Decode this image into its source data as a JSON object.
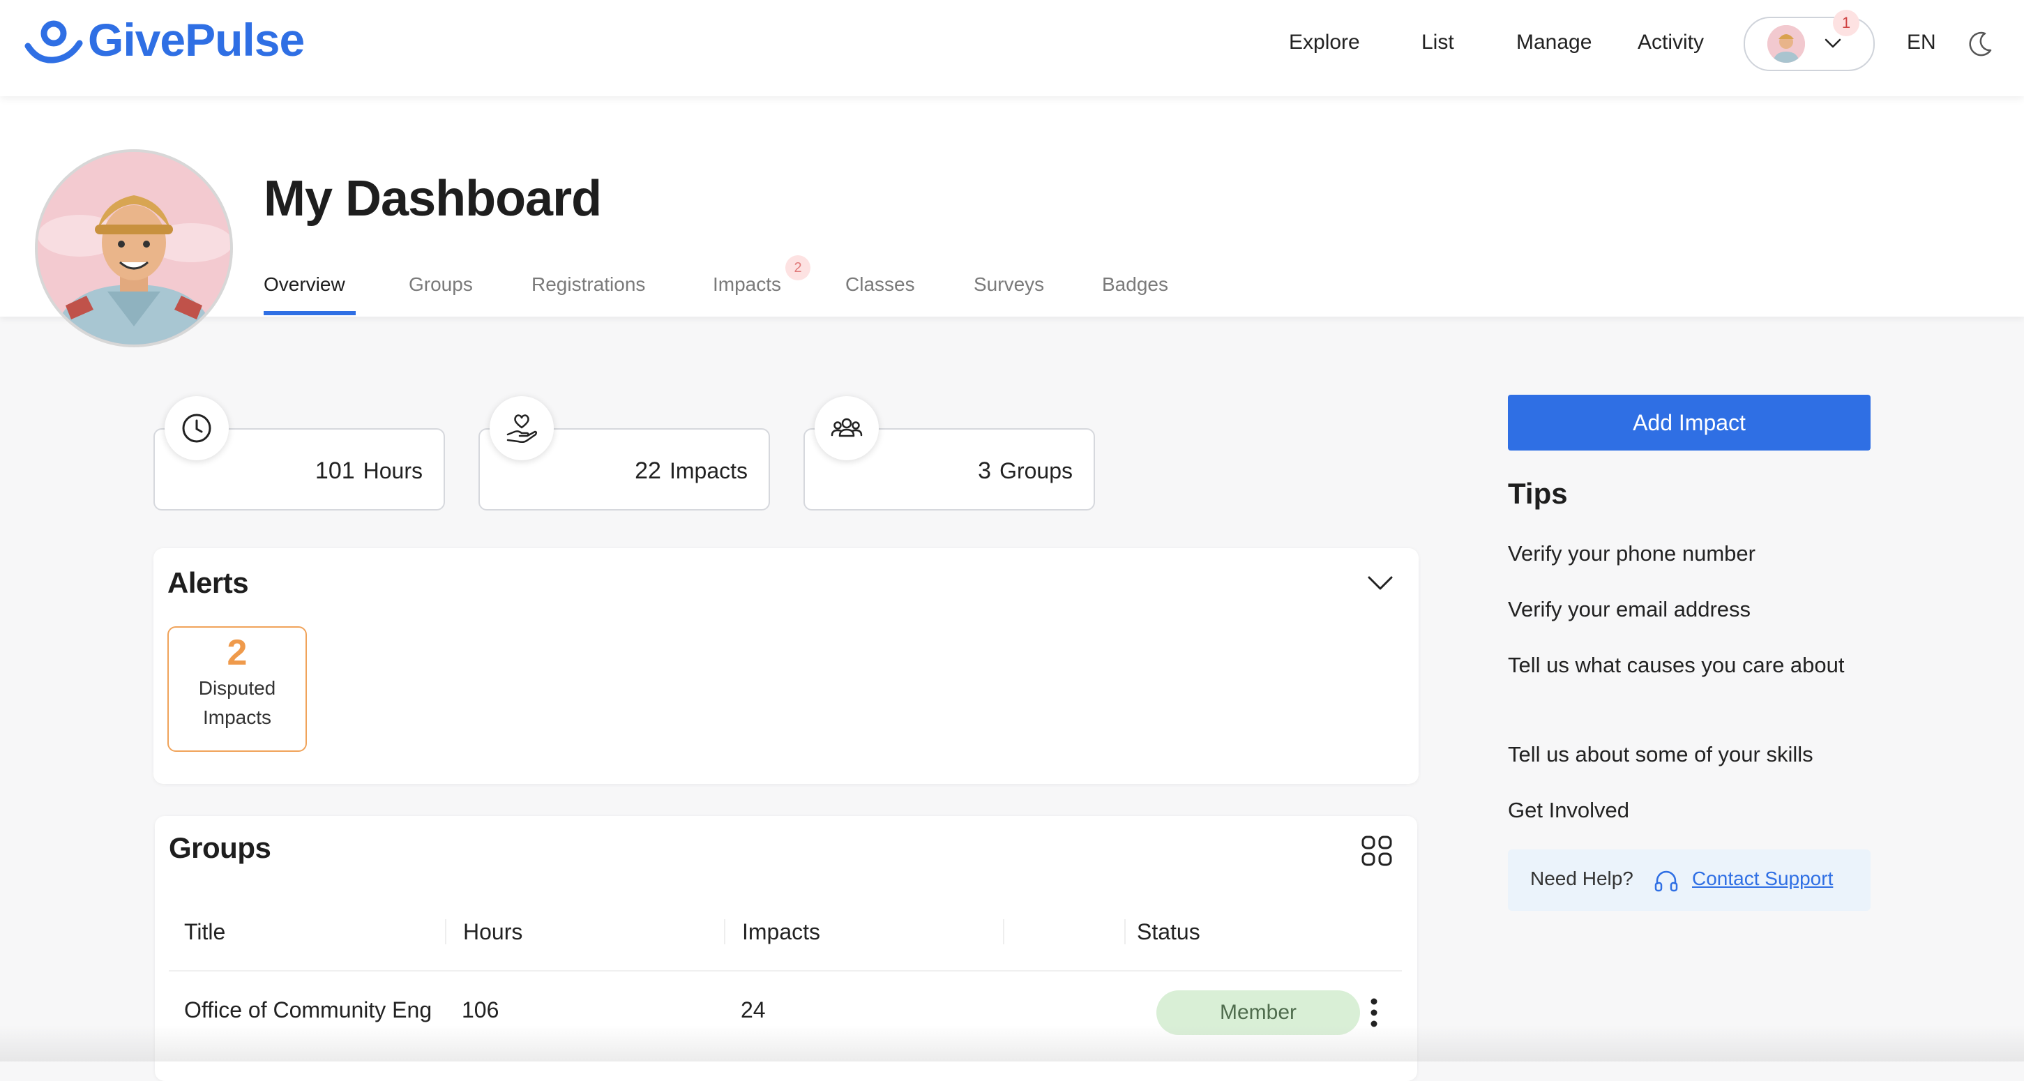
{
  "app": {
    "brand": "GivePulse"
  },
  "topnav": {
    "items": [
      "Explore",
      "List",
      "Manage",
      "Activity"
    ],
    "notification_count": "1",
    "language": "EN"
  },
  "header": {
    "title": "My Dashboard",
    "tabs": [
      "Overview",
      "Groups",
      "Registrations",
      "Impacts",
      "Classes",
      "Surveys",
      "Badges"
    ],
    "active_tab": "Overview",
    "impacts_tab_badge": "2"
  },
  "stats": [
    {
      "value": "101",
      "label": "Hours",
      "icon": "clock-icon"
    },
    {
      "value": "22",
      "label": "Impacts",
      "icon": "heart-hand-icon"
    },
    {
      "value": "3",
      "label": "Groups",
      "icon": "people-icon"
    }
  ],
  "alerts": {
    "title": "Alerts",
    "cards": [
      {
        "count": "2",
        "label_line1": "Disputed",
        "label_line2": "Impacts"
      }
    ]
  },
  "groups": {
    "title": "Groups",
    "columns": [
      "Title",
      "Hours",
      "Impacts",
      "",
      "Status"
    ],
    "rows": [
      {
        "title": "Office of Community Eng",
        "hours": "106",
        "impacts": "24",
        "status": "Member"
      }
    ]
  },
  "sidebar": {
    "add_button": "Add Impact",
    "tips_title": "Tips",
    "tips": [
      "Verify your phone number",
      "Verify your email address",
      "Tell us what causes you care about",
      "Tell us about some of your skills",
      "Get Involved"
    ],
    "help_text": "Need Help?",
    "help_link": "Contact Support"
  },
  "colors": {
    "brand": "#2f6fe4",
    "alert_orange": "#ef9a4b",
    "member_green": "#d9efd6",
    "badge_pink": "#fde2e2"
  }
}
